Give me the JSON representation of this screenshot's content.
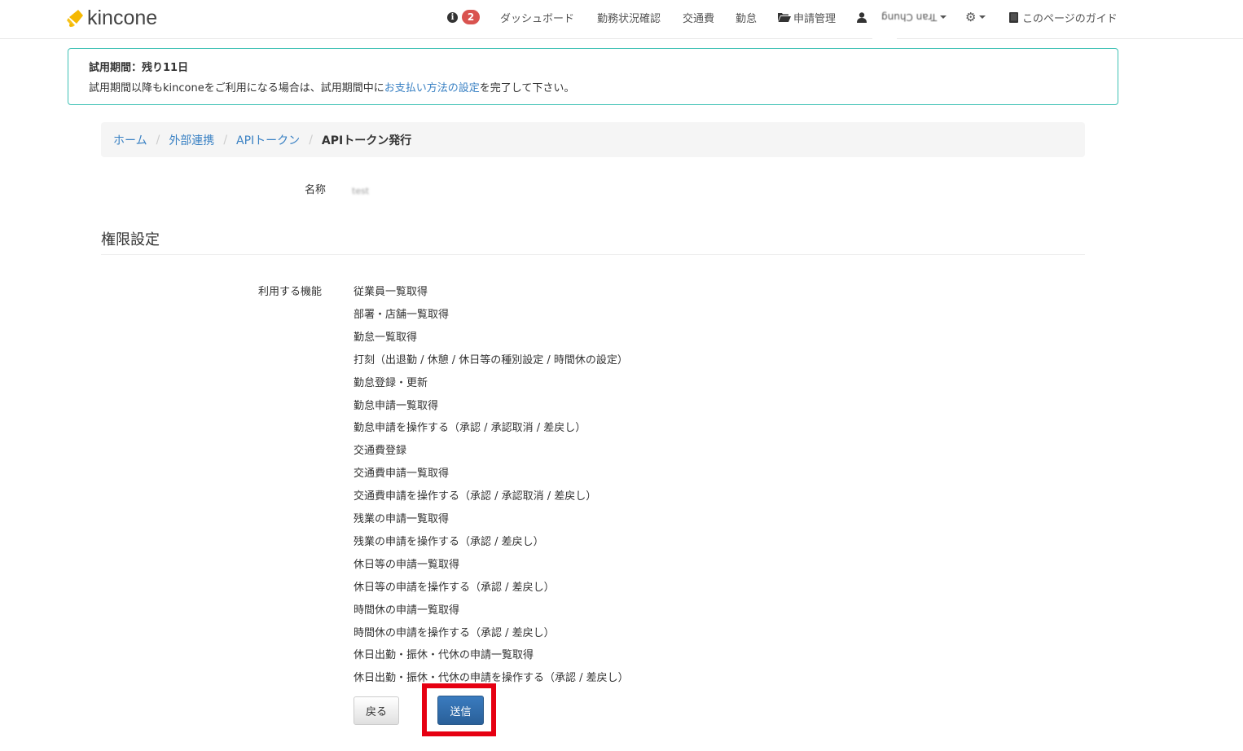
{
  "app": {
    "logo_text": "kincone"
  },
  "nav": {
    "notification_count": "2",
    "items": [
      "ダッシュボード",
      "勤務状況確認",
      "交通費",
      "勤怠",
      "申請管理"
    ],
    "user_name": "Tran Chung",
    "guide_label": "このページのガイド"
  },
  "alert": {
    "title": "試用期間：残り11日",
    "text_before": "試用期間以降もkinconeをご利用になる場合は、試用期間中に",
    "link_text": "お支払い方法の設定",
    "text_after": "を完了して下さい。"
  },
  "breadcrumb": {
    "items": [
      "ホーム",
      "外部連携",
      "APIトークン"
    ],
    "separator": "/",
    "active": "APIトークン発行"
  },
  "form": {
    "name_label": "名称",
    "name_value": "test",
    "section_title": "権限設定",
    "features_label": "利用する機能",
    "features": [
      "従業員一覧取得",
      "部署・店舗一覧取得",
      "勤怠一覧取得",
      "打刻（出退勤 / 休憩 / 休日等の種別設定 / 時間休の設定）",
      "勤怠登録・更新",
      "勤怠申請一覧取得",
      "勤怠申請を操作する（承認 / 承認取消 / 差戻し）",
      "交通費登録",
      "交通費申請一覧取得",
      "交通費申請を操作する（承認 / 承認取消 / 差戻し）",
      "残業の申請一覧取得",
      "残業の申請を操作する（承認 / 差戻し）",
      "休日等の申請一覧取得",
      "休日等の申請を操作する（承認 / 差戻し）",
      "時間休の申請一覧取得",
      "時間休の申請を操作する（承認 / 差戻し）",
      "休日出勤・振休・代休の申請一覧取得",
      "休日出勤・振休・代休の申請を操作する（承認 / 差戻し）"
    ],
    "back_label": "戻る",
    "submit_label": "送信"
  },
  "colors": {
    "accent": "#3b82c4",
    "alert_border": "#3fc1b5",
    "badge": "#d9534f",
    "highlight": "#e60012"
  }
}
